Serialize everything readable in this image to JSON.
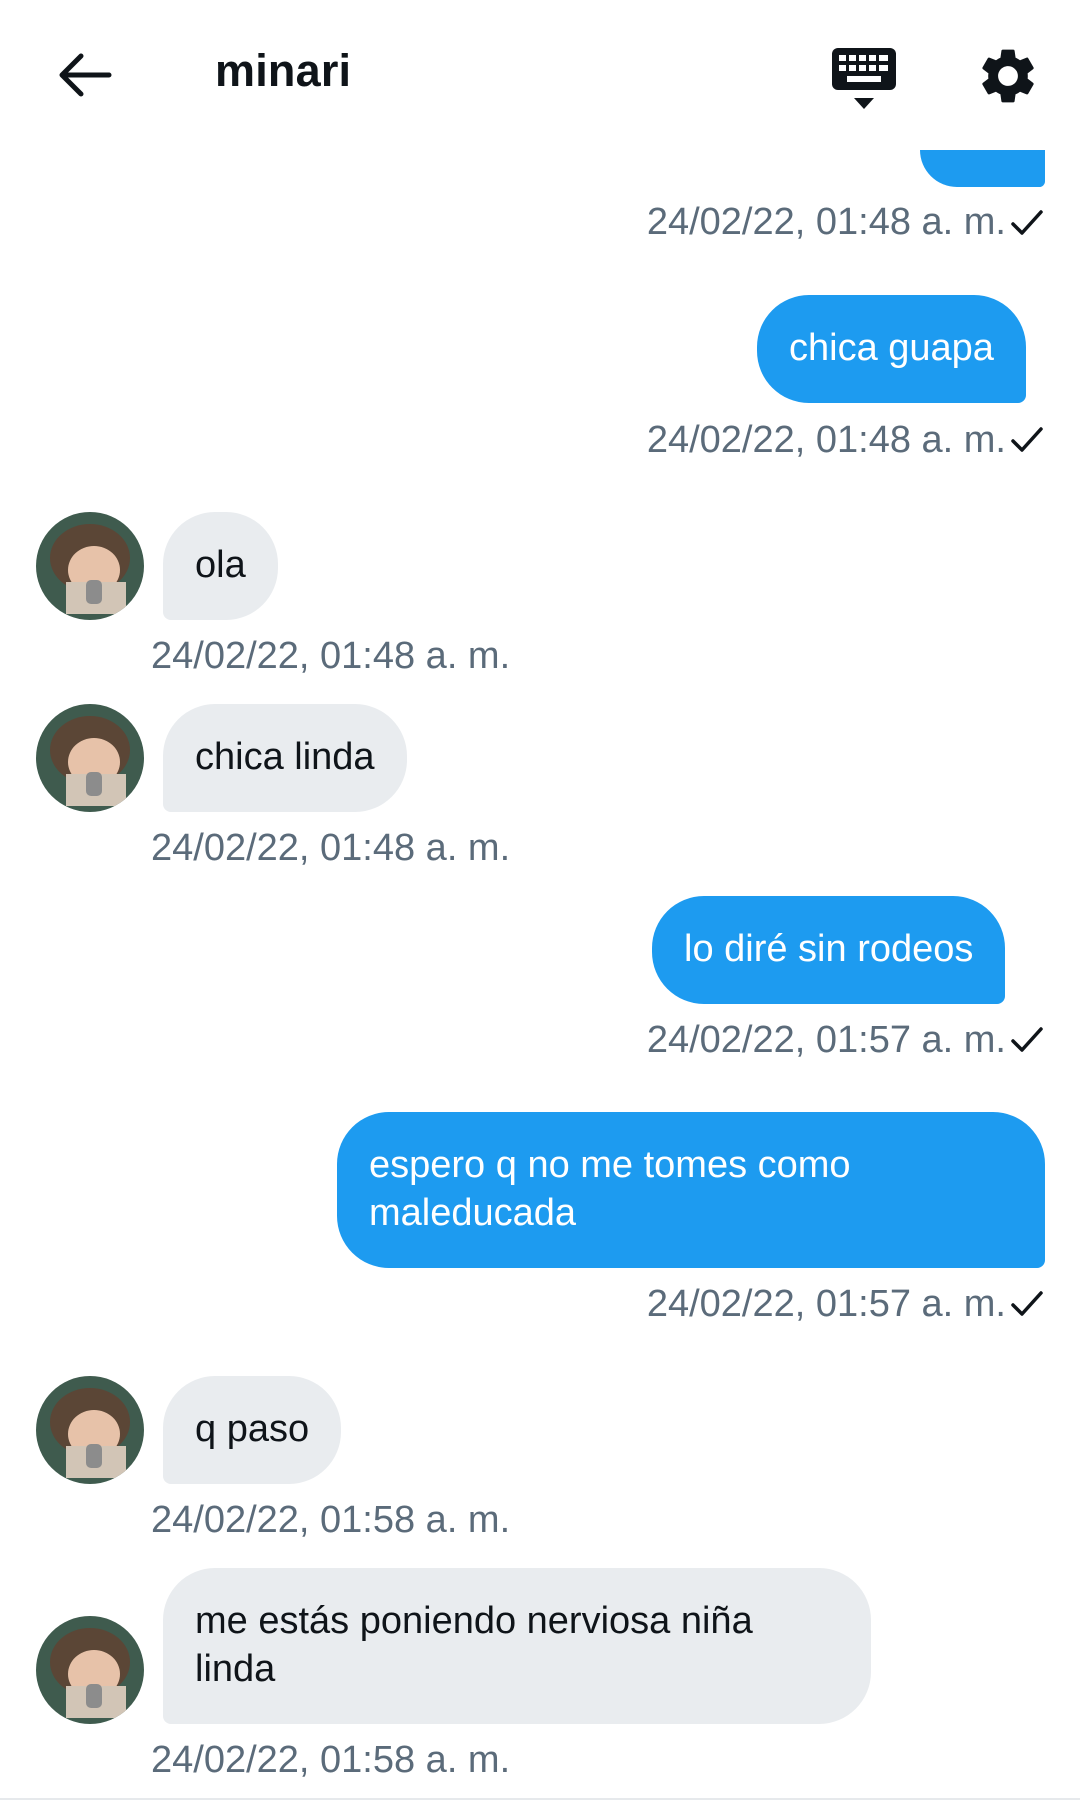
{
  "header": {
    "title": "minari",
    "back_icon": "arrow-left-icon",
    "keyboard_icon": "keyboard-icon",
    "settings_icon": "gear-icon"
  },
  "colors": {
    "outgoing_bubble": "#1d9bf0",
    "incoming_bubble": "#e9ecef",
    "timestamp": "#5b6b7a",
    "text_dark": "#0f1419"
  },
  "messages": [
    {
      "direction": "out",
      "text": "",
      "time": "24/02/22, 01:48 a. m.",
      "status": "sent"
    },
    {
      "direction": "out",
      "text": "chica guapa",
      "time": "24/02/22, 01:48 a. m.",
      "status": "sent"
    },
    {
      "direction": "in",
      "text": "ola",
      "time": "24/02/22, 01:48 a. m."
    },
    {
      "direction": "in",
      "text": "chica linda",
      "time": "24/02/22, 01:48 a. m."
    },
    {
      "direction": "out",
      "text": "lo diré sin rodeos",
      "time": "24/02/22, 01:57 a. m.",
      "status": "sent"
    },
    {
      "direction": "out",
      "text": "espero q no me tomes como\nmaleducada",
      "time": "24/02/22, 01:57 a. m.",
      "status": "sent"
    },
    {
      "direction": "in",
      "text": "q paso",
      "time": "24/02/22, 01:58 a. m."
    },
    {
      "direction": "in",
      "text": "me estás poniendo nerviosa niña\nlinda",
      "time": "24/02/22, 01:58 a. m."
    }
  ]
}
